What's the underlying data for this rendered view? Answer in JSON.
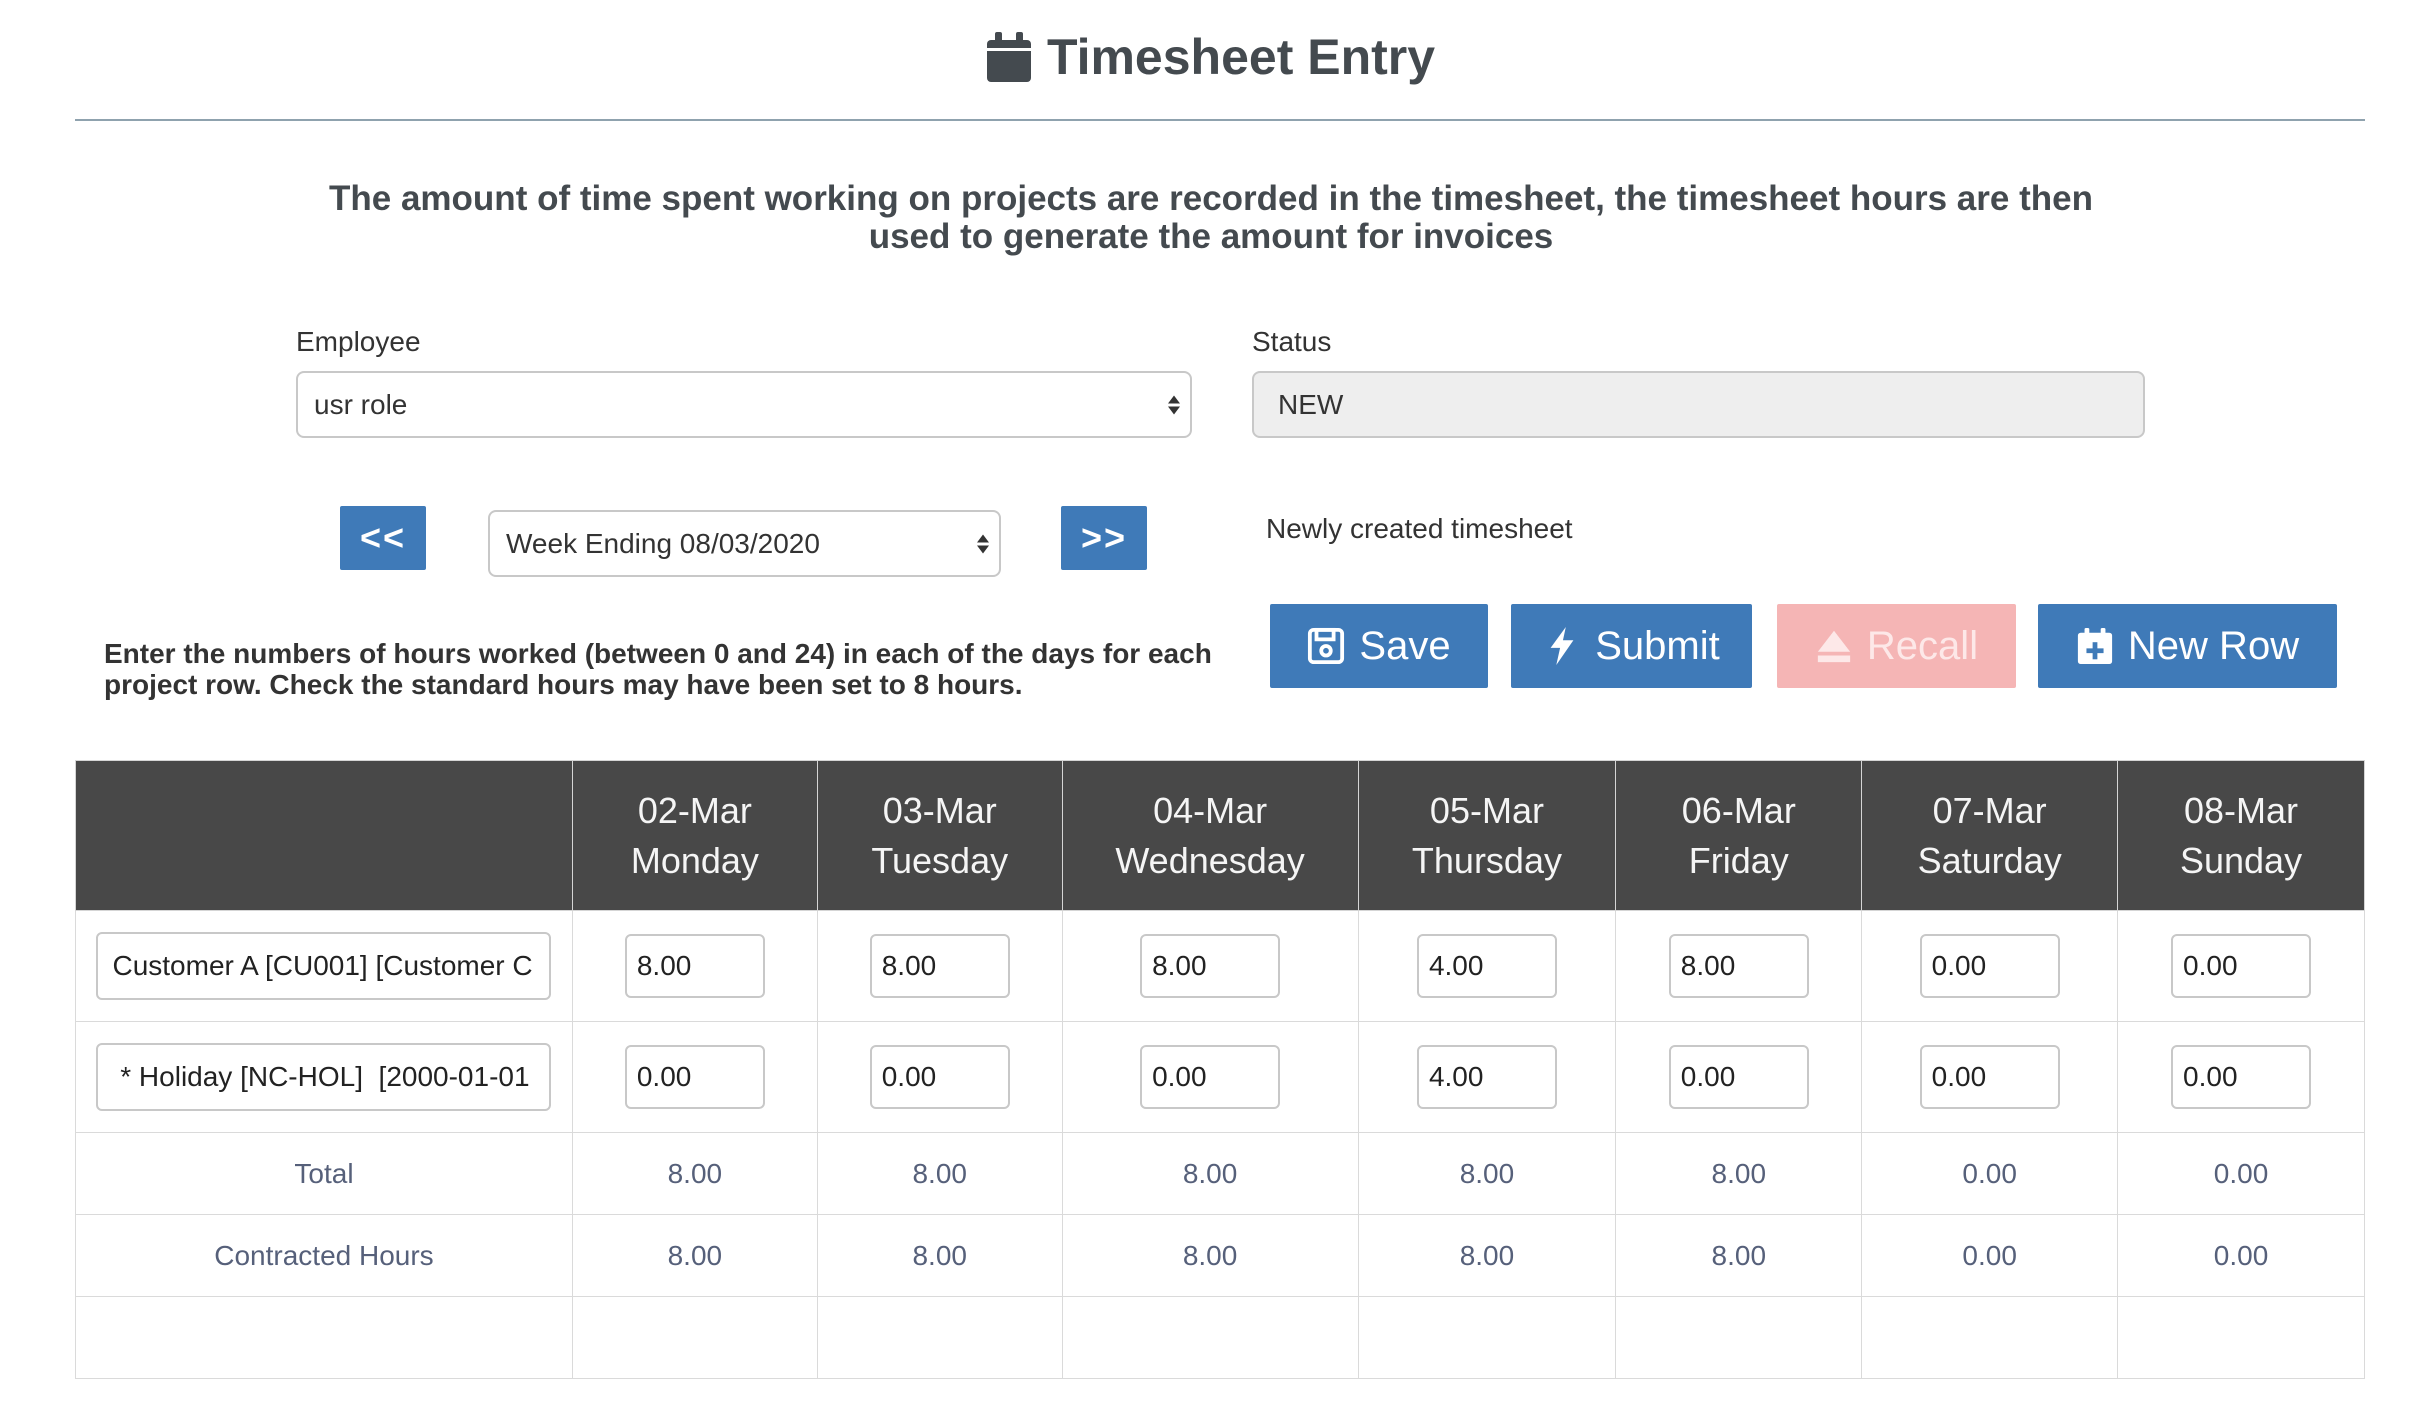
{
  "header": {
    "title": "Timesheet Entry",
    "icon": "calendar-icon",
    "intro": "The amount of time spent working on projects are recorded in the timesheet, the timesheet hours are then used to generate the amount for invoices"
  },
  "form": {
    "employee_label": "Employee",
    "employee_value": "usr role",
    "status_label": "Status",
    "status_value": "NEW",
    "prev_label": "<<",
    "next_label": ">>",
    "week_value": "Week Ending 08/03/2020",
    "status_message": "Newly created timesheet",
    "hint": "Enter the numbers of hours worked (between 0 and 24) in each of the days for each project row. Check the standard hours may have been set to 8 hours."
  },
  "actions": {
    "save": "Save",
    "submit": "Submit",
    "recall": "Recall",
    "new_row": "New Row"
  },
  "colors": {
    "primary": "#3f7ab8",
    "disabled": "#f5b5b5",
    "header_bg": "#484848"
  },
  "table": {
    "days": [
      {
        "date": "02-Mar",
        "day": "Monday"
      },
      {
        "date": "03-Mar",
        "day": "Tuesday"
      },
      {
        "date": "04-Mar",
        "day": "Wednesday"
      },
      {
        "date": "05-Mar",
        "day": "Thursday"
      },
      {
        "date": "06-Mar",
        "day": "Friday"
      },
      {
        "date": "07-Mar",
        "day": "Saturday"
      },
      {
        "date": "08-Mar",
        "day": "Sunday"
      }
    ],
    "rows": [
      {
        "project": "Customer A [CU001] [Customer C",
        "hours": [
          "8.00",
          "8.00",
          "8.00",
          "4.00",
          "8.00",
          "0.00",
          "0.00"
        ]
      },
      {
        "project": " * Holiday [NC-HOL]  [2000-01-01",
        "hours": [
          "0.00",
          "0.00",
          "0.00",
          "4.00",
          "0.00",
          "0.00",
          "0.00"
        ]
      }
    ],
    "total_label": "Total",
    "totals": [
      "8.00",
      "8.00",
      "8.00",
      "8.00",
      "8.00",
      "0.00",
      "0.00"
    ],
    "contracted_label": "Contracted Hours",
    "contracted": [
      "8.00",
      "8.00",
      "8.00",
      "8.00",
      "8.00",
      "0.00",
      "0.00"
    ]
  }
}
